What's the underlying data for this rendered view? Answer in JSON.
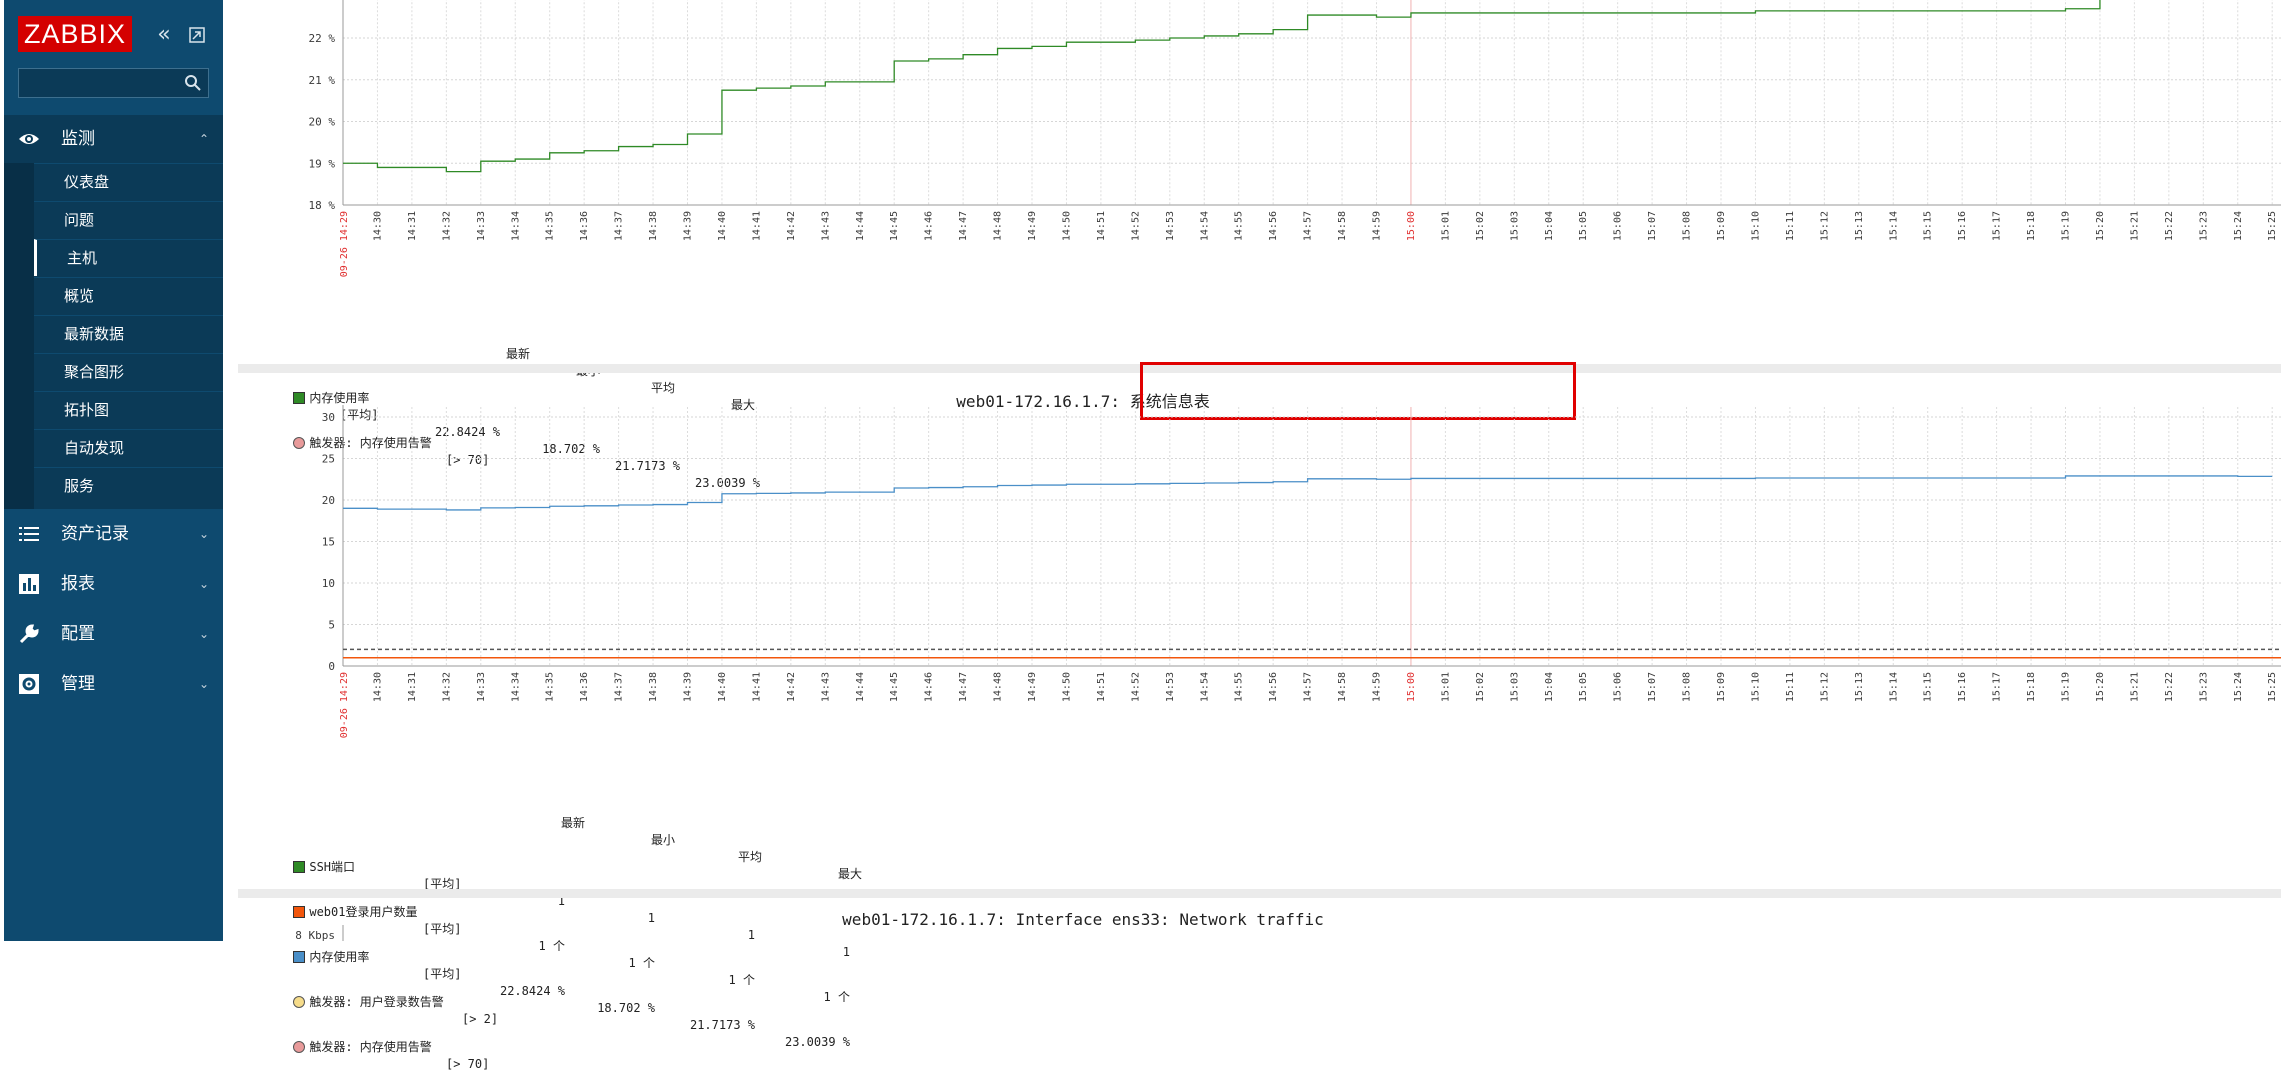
{
  "sidebar": {
    "logo": "ZABBIX",
    "collapse_icon": "double-chevron-left-icon",
    "kiosk_icon": "expand-window-icon",
    "search": {
      "value": "",
      "icon": "search-icon"
    },
    "menu": [
      {
        "label": "监测",
        "icon": "eye-icon",
        "expanded": true
      },
      {
        "label": "资产记录",
        "icon": "list-icon"
      },
      {
        "label": "报表",
        "icon": "bar-chart-icon"
      },
      {
        "label": "配置",
        "icon": "wrench-icon"
      },
      {
        "label": "管理",
        "icon": "gear-icon"
      }
    ],
    "submenu": [
      "仪表盘",
      "问题",
      "主机",
      "概览",
      "最新数据",
      "聚合图形",
      "拓扑图",
      "自动发现",
      "服务"
    ],
    "active_submenu": "主机"
  },
  "x_ticks": [
    "14:30",
    "14:31",
    "14:32",
    "14:33",
    "14:34",
    "14:35",
    "14:36",
    "14:37",
    "14:38",
    "14:39",
    "14:40",
    "14:41",
    "14:42",
    "14:43",
    "14:44",
    "14:45",
    "14:46",
    "14:47",
    "14:48",
    "14:49",
    "14:50",
    "14:51",
    "14:52",
    "14:53",
    "14:54",
    "14:55",
    "14:56",
    "14:57",
    "14:58",
    "14:59",
    "15:00",
    "15:01",
    "15:02",
    "15:03",
    "15:04",
    "15:05",
    "15:06",
    "15:07",
    "15:08",
    "15:09",
    "15:10",
    "15:11",
    "15:12",
    "15:13",
    "15:14",
    "15:15",
    "15:16",
    "15:17",
    "15:18",
    "15:19",
    "15:20",
    "15:21",
    "15:22",
    "15:23",
    "15:24",
    "15:25"
  ],
  "x_start_label": "09-26 14:29",
  "chart1": {
    "legend_headers": [
      "最新",
      "最小",
      "平均",
      "最大"
    ],
    "items": [
      {
        "name": "内存使用率",
        "func": "[平均]",
        "latest": "22.8424 %",
        "min": "18.702 %",
        "avg": "21.7173 %",
        "max": "23.0039 %",
        "color": "#2f8a26"
      }
    ],
    "triggers": [
      {
        "text": "触发器: 内存使用告警",
        "cond": "[> 70]",
        "color": "#e89a9a"
      }
    ]
  },
  "chart2": {
    "title": "web01-172.16.1.7: 系统信息表",
    "legend_headers": [
      "最新",
      "最小",
      "平均",
      "最大"
    ],
    "items": [
      {
        "name": "SSH端口",
        "func": "[平均]",
        "latest": "1",
        "min": "1",
        "avg": "1",
        "max": "1",
        "color": "#2f8a26"
      },
      {
        "name": "web01登录用户数量",
        "func": "[平均]",
        "latest": "1 个",
        "min": "1 个",
        "avg": "1 个",
        "max": "1 个",
        "color": "#f2560c"
      },
      {
        "name": "内存使用率",
        "func": "[平均]",
        "latest": "22.8424 %",
        "min": "18.702 %",
        "avg": "21.7173 %",
        "max": "23.0039 %",
        "color": "#4a8fc8"
      }
    ],
    "triggers": [
      {
        "text": "触发器: 用户登录数告警",
        "cond": "[> 2]",
        "color": "#f6dc8a"
      },
      {
        "text": "触发器: 内存使用告警",
        "cond": "[> 70]",
        "color": "#e89a9a"
      }
    ]
  },
  "chart3": {
    "title": "web01-172.16.1.7: Interface ens33: Network traffic",
    "first_y_label": "8 Kbps"
  },
  "chart_data": [
    {
      "type": "line",
      "ylim": [
        18,
        23
      ],
      "y_ticks": [
        "18 %",
        "19 %",
        "20 %",
        "21 %",
        "22 %"
      ],
      "series": [
        {
          "name": "内存使用率",
          "color": "#2f8a26",
          "x": [
            "14:29",
            "14:30",
            "14:31",
            "14:32",
            "14:33",
            "14:34",
            "14:35",
            "14:36",
            "14:37",
            "14:38",
            "14:39",
            "14:40",
            "14:41",
            "14:42",
            "14:43",
            "14:44",
            "14:45",
            "14:46",
            "14:47",
            "14:48",
            "14:49",
            "14:50",
            "14:51",
            "14:52",
            "14:53",
            "14:54",
            "14:55",
            "14:56",
            "14:57",
            "14:58",
            "14:59",
            "15:00",
            "15:01",
            "15:02",
            "15:03",
            "15:04",
            "15:05",
            "15:06",
            "15:07",
            "15:08",
            "15:09",
            "15:10",
            "15:11",
            "15:12",
            "15:13",
            "15:14",
            "15:15",
            "15:16",
            "15:17",
            "15:18",
            "15:19",
            "15:20"
          ],
          "values": [
            19.0,
            18.9,
            18.9,
            18.8,
            19.05,
            19.1,
            19.25,
            19.3,
            19.4,
            19.45,
            19.7,
            20.75,
            20.8,
            20.85,
            20.95,
            20.95,
            21.45,
            21.5,
            21.6,
            21.75,
            21.8,
            21.9,
            21.9,
            21.95,
            22.0,
            22.05,
            22.1,
            22.2,
            22.55,
            22.55,
            22.5,
            22.6,
            22.6,
            22.6,
            22.6,
            22.6,
            22.6,
            22.6,
            22.6,
            22.6,
            22.6,
            22.65,
            22.65,
            22.65,
            22.65,
            22.65,
            22.65,
            22.65,
            22.65,
            22.65,
            22.7,
            23.0
          ]
        }
      ]
    },
    {
      "type": "line",
      "ylim": [
        0,
        30
      ],
      "y_ticks": [
        "0",
        "5",
        "10",
        "15",
        "20",
        "25",
        "30"
      ],
      "series": [
        {
          "name": "SSH端口",
          "color": "#2f8a26",
          "constant": 1
        },
        {
          "name": "web01登录用户数量",
          "color": "#f2560c",
          "constant": 1
        },
        {
          "name": "内存使用率",
          "color": "#4a8fc8",
          "x": [
            "14:29",
            "14:30",
            "14:31",
            "14:32",
            "14:33",
            "14:34",
            "14:35",
            "14:36",
            "14:37",
            "14:38",
            "14:39",
            "14:40",
            "14:41",
            "14:42",
            "14:43",
            "14:44",
            "14:45",
            "14:46",
            "14:47",
            "14:48",
            "14:49",
            "14:50",
            "14:51",
            "14:52",
            "14:53",
            "14:54",
            "14:55",
            "14:56",
            "14:57",
            "14:58",
            "14:59",
            "15:00",
            "15:01",
            "15:02",
            "15:03",
            "15:04",
            "15:05",
            "15:06",
            "15:07",
            "15:08",
            "15:09",
            "15:10",
            "15:11",
            "15:12",
            "15:13",
            "15:14",
            "15:15",
            "15:16",
            "15:17",
            "15:18",
            "15:19",
            "15:20",
            "15:21",
            "15:22",
            "15:23",
            "15:24",
            "15:25"
          ],
          "values": [
            19.0,
            18.9,
            18.9,
            18.8,
            19.05,
            19.1,
            19.25,
            19.3,
            19.4,
            19.45,
            19.7,
            20.75,
            20.8,
            20.85,
            20.95,
            20.95,
            21.45,
            21.5,
            21.6,
            21.75,
            21.8,
            21.9,
            21.9,
            21.95,
            22.0,
            22.05,
            22.1,
            22.2,
            22.55,
            22.55,
            22.5,
            22.6,
            22.6,
            22.6,
            22.6,
            22.6,
            22.6,
            22.6,
            22.6,
            22.6,
            22.6,
            22.65,
            22.65,
            22.65,
            22.65,
            22.65,
            22.65,
            22.65,
            22.65,
            22.65,
            22.9,
            22.9,
            22.9,
            22.9,
            22.9,
            22.85,
            22.85
          ]
        }
      ],
      "triggers": [
        {
          "name": "触发器: 用户登录数告警",
          "value": 2,
          "color": "#555555"
        },
        {
          "name": "触发器: 内存使用告警",
          "value": 70,
          "color": "#e04040"
        }
      ]
    }
  ]
}
